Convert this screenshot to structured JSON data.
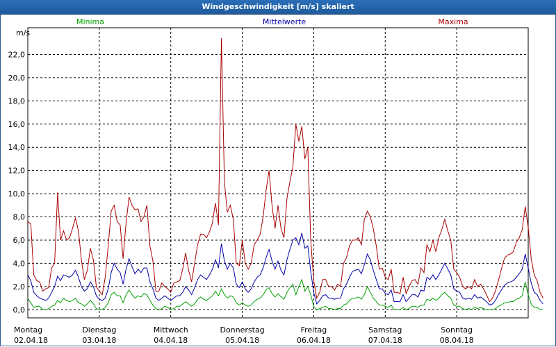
{
  "window": {
    "title": "Windgeschwindigkeit [m/s] skaliert"
  },
  "legend": {
    "min_label": "Minima",
    "mean_label": "Mittelwerte",
    "max_label": "Maxima"
  },
  "colors": {
    "min": "#00a000",
    "mean": "#0000aa",
    "max": "#aa0000",
    "title_bar": "#2a6fb8"
  },
  "chart_data": {
    "type": "line",
    "title": "Windgeschwindigkeit [m/s] skaliert",
    "ylabel": "m/s",
    "ylim": [
      -0.7,
      24.3
    ],
    "yticks": [
      "0,0",
      "2,0",
      "4,0",
      "6,0",
      "8,0",
      "10,0",
      "12,0",
      "14,0",
      "16,0",
      "18,0",
      "20,0",
      "22,0"
    ],
    "days": [
      {
        "weekday": "Montag",
        "date": "02.04.18"
      },
      {
        "weekday": "Dienstag",
        "date": "03.04.18"
      },
      {
        "weekday": "Mittwoch",
        "date": "04.04.18"
      },
      {
        "weekday": "Donnerstag",
        "date": "05.04.18"
      },
      {
        "weekday": "Freitag",
        "date": "06.04.18"
      },
      {
        "weekday": "Samstag",
        "date": "07.04.18"
      },
      {
        "weekday": "Sonntag",
        "date": "08.04.18"
      }
    ],
    "x_points_per_day": 24,
    "grid": true,
    "series": [
      {
        "name": "Maxima",
        "values": [
          7.6,
          7.4,
          3.0,
          2.5,
          2.4,
          1.6,
          1.8,
          1.9,
          3.6,
          4.0,
          10.1,
          6.0,
          6.8,
          6.0,
          6.2,
          7.0,
          7.9,
          6.8,
          4.3,
          2.6,
          3.4,
          5.3,
          4.3,
          2.0,
          1.6,
          1.3,
          2.8,
          5.5,
          8.5,
          9.0,
          7.6,
          7.3,
          4.4,
          7.5,
          9.7,
          9.0,
          8.6,
          8.7,
          7.6,
          8.0,
          9.0,
          5.5,
          4.2,
          1.6,
          1.6,
          2.3,
          2.0,
          1.8,
          1.5,
          2.3,
          2.4,
          2.5,
          3.5,
          4.9,
          3.4,
          2.4,
          4.0,
          5.6,
          6.5,
          6.5,
          6.2,
          6.7,
          7.5,
          9.2,
          7.3,
          23.4,
          11.0,
          8.4,
          9.0,
          7.8,
          4.0,
          3.8,
          6.0,
          4.0,
          3.5,
          4.0,
          5.6,
          6.0,
          6.5,
          8.0,
          10.3,
          12.0,
          9.0,
          7.0,
          9.0,
          7.0,
          6.2,
          9.6,
          11.0,
          12.3,
          16.0,
          14.5,
          15.8,
          13.0,
          14.0,
          6.0,
          2.5,
          1.0,
          1.5,
          2.6,
          2.6,
          2.0,
          2.0,
          1.7,
          2.2,
          2.0,
          4.0,
          4.5,
          5.5,
          6.0,
          6.0,
          6.2,
          5.6,
          7.8,
          8.5,
          8.0,
          7.0,
          5.5,
          3.5,
          3.6,
          2.8,
          2.6,
          3.5,
          1.5,
          1.5,
          1.4,
          2.8,
          1.4,
          2.0,
          2.5,
          2.6,
          2.2,
          3.6,
          3.2,
          5.6,
          5.0,
          6.0,
          5.0,
          6.2,
          6.9,
          7.8,
          6.8,
          6.0,
          3.5,
          3.2,
          2.8,
          2.0,
          1.8,
          2.0,
          1.8,
          2.6,
          2.0,
          2.2,
          1.8,
          1.3,
          0.7,
          1.0,
          1.6,
          2.5,
          3.5,
          4.4,
          4.7,
          4.8,
          5.0,
          5.8,
          6.2,
          6.9,
          8.9,
          7.1,
          4.4,
          3.0,
          2.5,
          1.5,
          1.0
        ]
      },
      {
        "name": "Mittelwerte",
        "values": [
          3.0,
          2.5,
          1.5,
          1.2,
          1.0,
          0.9,
          0.8,
          1.0,
          1.5,
          2.0,
          2.9,
          2.5,
          3.0,
          2.9,
          2.8,
          3.0,
          3.4,
          2.8,
          2.0,
          1.6,
          1.8,
          2.4,
          2.0,
          1.2,
          0.9,
          0.8,
          1.0,
          1.8,
          3.2,
          4.0,
          3.5,
          3.2,
          2.2,
          3.5,
          4.4,
          3.7,
          3.1,
          3.5,
          3.2,
          3.6,
          3.6,
          2.4,
          1.8,
          1.0,
          0.8,
          1.0,
          1.2,
          1.0,
          0.8,
          1.0,
          1.2,
          1.2,
          1.5,
          2.0,
          1.7,
          1.3,
          1.9,
          2.6,
          3.0,
          2.8,
          2.6,
          3.0,
          3.5,
          4.3,
          3.6,
          5.7,
          4.2,
          3.5,
          4.0,
          3.6,
          2.2,
          1.9,
          2.4,
          1.8,
          1.5,
          1.8,
          2.4,
          2.8,
          3.0,
          3.6,
          4.5,
          5.2,
          4.2,
          3.5,
          4.2,
          3.4,
          3.0,
          4.3,
          5.2,
          6.0,
          6.2,
          5.6,
          6.6,
          5.3,
          5.5,
          3.3,
          1.5,
          0.5,
          0.8,
          1.2,
          1.3,
          1.0,
          1.0,
          0.9,
          1.0,
          1.0,
          1.8,
          2.2,
          2.8,
          3.3,
          3.4,
          3.5,
          3.1,
          3.9,
          4.8,
          4.3,
          3.4,
          2.6,
          1.8,
          1.8,
          1.4,
          1.3,
          1.7,
          0.7,
          0.7,
          0.7,
          1.3,
          0.7,
          1.0,
          1.3,
          1.3,
          1.1,
          1.7,
          1.6,
          2.8,
          2.6,
          3.0,
          2.6,
          3.0,
          3.5,
          4.0,
          3.5,
          3.0,
          1.8,
          1.6,
          1.5,
          1.0,
          0.9,
          1.0,
          0.9,
          1.3,
          1.0,
          1.1,
          0.9,
          0.7,
          0.4,
          0.5,
          0.8,
          1.3,
          1.7,
          2.1,
          2.3,
          2.4,
          2.5,
          2.8,
          3.1,
          3.5,
          4.8,
          3.6,
          2.3,
          1.5,
          1.3,
          0.8,
          0.5
        ]
      },
      {
        "name": "Minima",
        "values": [
          1.0,
          0.6,
          0.2,
          0.3,
          0.3,
          0.0,
          0.0,
          0.1,
          0.3,
          0.4,
          0.8,
          0.6,
          1.0,
          0.8,
          0.7,
          0.8,
          1.0,
          0.6,
          0.5,
          0.3,
          0.5,
          0.8,
          0.5,
          0.1,
          0.0,
          0.0,
          0.2,
          0.6,
          1.3,
          1.5,
          1.2,
          1.2,
          0.6,
          1.3,
          1.7,
          1.3,
          1.0,
          1.2,
          1.1,
          1.4,
          1.3,
          0.8,
          0.4,
          0.1,
          0.0,
          0.1,
          0.3,
          0.2,
          0.0,
          0.1,
          0.3,
          0.3,
          0.5,
          0.7,
          0.5,
          0.3,
          0.5,
          0.9,
          1.1,
          0.9,
          0.8,
          1.0,
          1.2,
          1.6,
          1.2,
          1.8,
          1.3,
          1.0,
          1.2,
          1.1,
          0.6,
          0.4,
          0.6,
          0.4,
          0.3,
          0.4,
          0.7,
          0.9,
          1.0,
          1.3,
          1.7,
          1.9,
          1.4,
          1.1,
          1.4,
          1.1,
          0.9,
          1.5,
          1.9,
          2.2,
          1.3,
          2.0,
          2.6,
          1.6,
          2.0,
          1.3,
          0.3,
          0.0,
          0.1,
          0.2,
          0.3,
          0.1,
          0.1,
          0.0,
          0.1,
          0.1,
          0.4,
          0.5,
          0.8,
          1.0,
          1.0,
          1.1,
          0.9,
          1.3,
          2.0,
          1.5,
          1.0,
          0.7,
          0.4,
          0.4,
          0.3,
          0.2,
          0.4,
          0.0,
          0.0,
          0.0,
          0.2,
          0.0,
          0.1,
          0.3,
          0.3,
          0.2,
          0.4,
          0.4,
          0.9,
          0.8,
          1.0,
          0.8,
          1.0,
          1.3,
          1.5,
          1.2,
          1.0,
          0.4,
          0.3,
          0.3,
          0.1,
          0.0,
          0.1,
          0.0,
          0.2,
          0.1,
          0.2,
          0.1,
          0.0,
          0.0,
          0.0,
          0.1,
          0.3,
          0.4,
          0.6,
          0.6,
          0.7,
          0.7,
          0.9,
          1.0,
          1.2,
          2.4,
          1.3,
          0.5,
          0.2,
          0.2,
          0.0,
          0.0
        ]
      }
    ]
  }
}
